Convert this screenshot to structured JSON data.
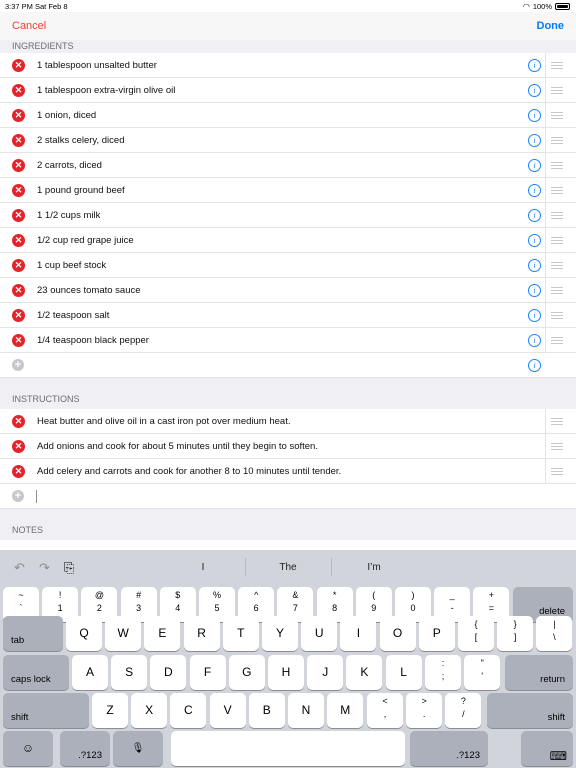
{
  "status": {
    "time": "3:37 PM",
    "date": "Sat Feb 8",
    "battery": "100%"
  },
  "nav": {
    "cancel": "Cancel",
    "done": "Done"
  },
  "ingredients": {
    "header": "INGREDIENTS",
    "items": [
      "1 tablespoon unsalted butter",
      "1 tablespoon extra-virgin olive oil",
      "1 onion, diced",
      "2 stalks celery, diced",
      "2 carrots, diced",
      "1 pound ground beef",
      "1 1/2 cups milk",
      "1/2 cup red grape juice",
      "1 cup beef stock",
      "23 ounces tomato sauce",
      "1/2 teaspoon salt",
      "1/4 teaspoon black pepper"
    ]
  },
  "instructions": {
    "header": "INSTRUCTIONS",
    "items": [
      "Heat butter and olive oil in a cast iron pot over medium heat.",
      "Add onions and cook for about 5 minutes until they begin to soften.",
      "Add celery and carrots and cook for another 8 to 10 minutes until tender."
    ]
  },
  "notes": {
    "header": "NOTES"
  },
  "glyphs": {
    "delete": "✕",
    "add": "+",
    "info": "i",
    "undo": "↶",
    "redo": "↷",
    "paste": "⎘"
  },
  "keyboard": {
    "suggestions": [
      "I",
      "The",
      "I’m"
    ],
    "row1": [
      {
        "t": "~",
        "b": "`"
      },
      {
        "t": "!",
        "b": "1"
      },
      {
        "t": "@",
        "b": "2"
      },
      {
        "t": "#",
        "b": "3"
      },
      {
        "t": "$",
        "b": "4"
      },
      {
        "t": "%",
        "b": "5"
      },
      {
        "t": "^",
        "b": "6"
      },
      {
        "t": "&",
        "b": "7"
      },
      {
        "t": "*",
        "b": "8"
      },
      {
        "t": "(",
        "b": "9"
      },
      {
        "t": ")",
        "b": "0"
      },
      {
        "t": "_",
        "b": "-"
      },
      {
        "t": "+",
        "b": "="
      }
    ],
    "delete": "delete",
    "tab": "tab",
    "row2": [
      "Q",
      "W",
      "E",
      "R",
      "T",
      "Y",
      "U",
      "I",
      "O",
      "P"
    ],
    "row2_punct": [
      {
        "t": "{",
        "b": "["
      },
      {
        "t": "}",
        "b": "]"
      },
      {
        "t": "|",
        "b": "\\"
      }
    ],
    "caps_lock": "caps lock",
    "row3": [
      "A",
      "S",
      "D",
      "F",
      "G",
      "H",
      "J",
      "K",
      "L"
    ],
    "row3_punct": [
      {
        "t": ":",
        "b": ";"
      },
      {
        "t": "\"",
        "b": "'"
      }
    ],
    "return": "return",
    "shift": "shift",
    "row4": [
      "Z",
      "X",
      "C",
      "V",
      "B",
      "N",
      "M"
    ],
    "row4_punct": [
      {
        "t": "<",
        "b": ","
      },
      {
        "t": ">",
        "b": "."
      },
      {
        "t": "?",
        "b": "/"
      }
    ],
    "numbers": ".?123",
    "emoji": "☺",
    "mic": "🎙",
    "hide": "⌨"
  }
}
